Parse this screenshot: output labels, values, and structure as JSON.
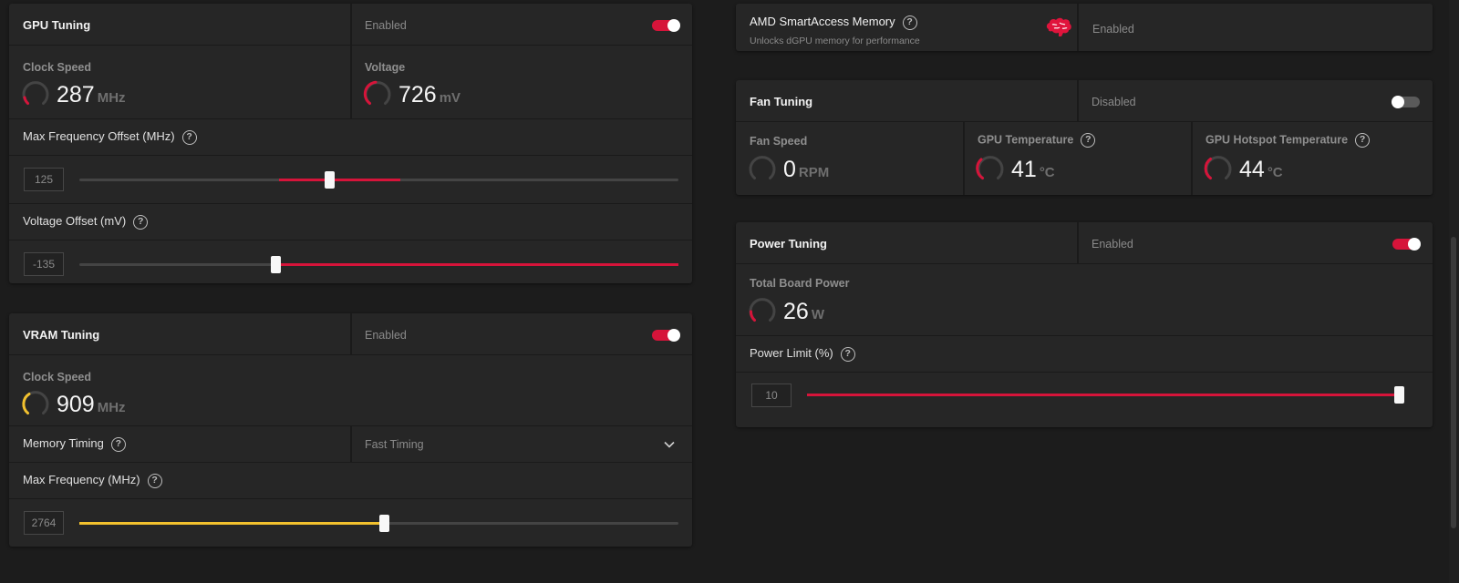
{
  "colors": {
    "accent": "#d6143a",
    "vram_accent": "#f2c12e",
    "panel": "#262626",
    "bg": "#1c1c1c"
  },
  "gpu_tuning": {
    "title": "GPU Tuning",
    "state": "Enabled",
    "toggle_on": true,
    "clock": {
      "label": "Clock Speed",
      "value": "287",
      "unit": "MHz"
    },
    "voltage": {
      "label": "Voltage",
      "value": "726",
      "unit": "mV"
    },
    "max_freq_offset": {
      "label": "Max Frequency Offset (MHz)",
      "help": "?",
      "value": "125",
      "position": 0.42
    },
    "voltage_offset": {
      "label": "Voltage Offset (mV)",
      "help": "?",
      "value": "-135",
      "position": 0.33
    }
  },
  "vram_tuning": {
    "title": "VRAM Tuning",
    "state": "Enabled",
    "toggle_on": true,
    "clock": {
      "label": "Clock Speed",
      "value": "909",
      "unit": "MHz"
    },
    "memory_timing": {
      "label": "Memory Timing",
      "help": "?",
      "selected": "Fast Timing"
    },
    "max_frequency": {
      "label": "Max Frequency (MHz)",
      "help": "?",
      "value": "2764",
      "position": 0.51
    }
  },
  "smart_access": {
    "title": "AMD SmartAccess Memory",
    "help": "?",
    "subtitle": "Unlocks dGPU memory for performance",
    "state": "Enabled",
    "icon": "brain-icon"
  },
  "fan_tuning": {
    "title": "Fan Tuning",
    "state": "Disabled",
    "toggle_on": false,
    "fan_speed": {
      "label": "Fan Speed",
      "value": "0",
      "unit": "RPM"
    },
    "gpu_temp": {
      "label": "GPU Temperature",
      "help": "?",
      "value": "41",
      "unit": "°C"
    },
    "hotspot_temp": {
      "label": "GPU Hotspot Temperature",
      "help": "?",
      "value": "44",
      "unit": "°C"
    }
  },
  "power_tuning": {
    "title": "Power Tuning",
    "state": "Enabled",
    "toggle_on": true,
    "board_power": {
      "label": "Total Board Power",
      "value": "26",
      "unit": "W"
    },
    "power_limit": {
      "label": "Power Limit (%)",
      "help": "?",
      "value": "10",
      "position": 1.0
    }
  }
}
